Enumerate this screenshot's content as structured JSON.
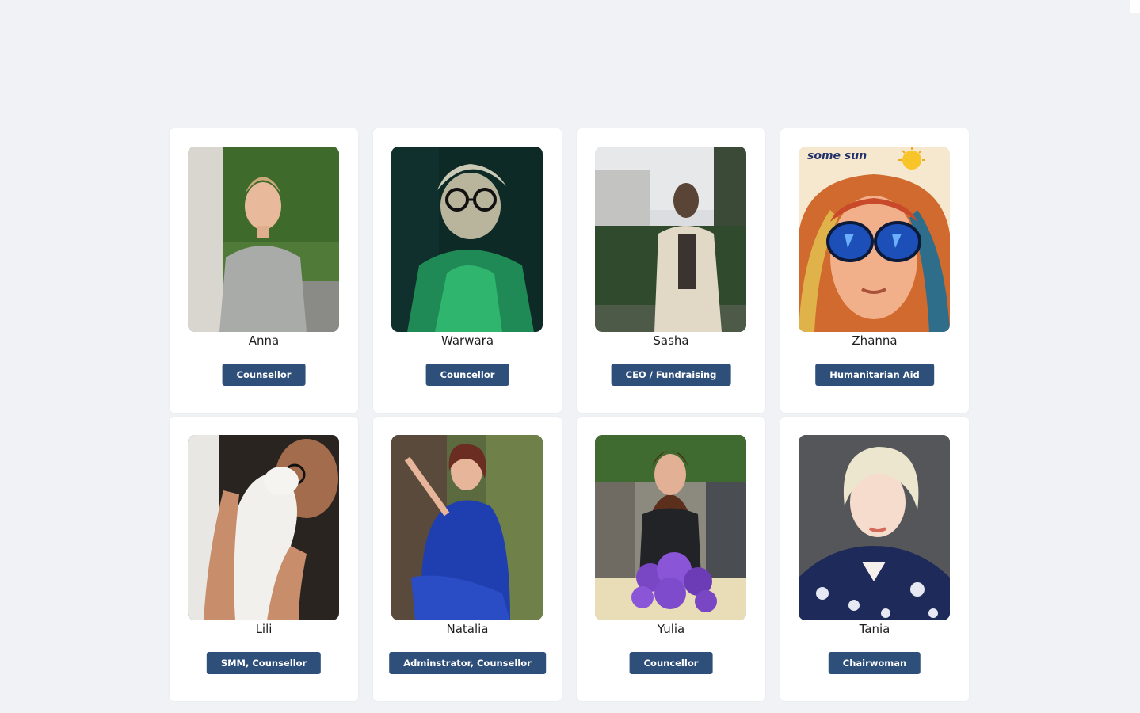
{
  "team": [
    {
      "name": "Anna",
      "role": "Counsellor",
      "photo_icon": "portrait-photo"
    },
    {
      "name": "Warwara",
      "role": "Councellor",
      "photo_icon": "portrait-photo"
    },
    {
      "name": "Sasha",
      "role": "CEO / Fundraising",
      "photo_icon": "portrait-photo"
    },
    {
      "name": "Zhanna",
      "role": "Humanitarian Aid",
      "photo_icon": "portrait-photo",
      "photo_caption": "some sun"
    },
    {
      "name": "Lili",
      "role": "SMM, Counsellor",
      "photo_icon": "portrait-photo"
    },
    {
      "name": "Natalia",
      "role": "Adminstrator, Counsellor",
      "photo_icon": "portrait-photo"
    },
    {
      "name": "Yulia",
      "role": "Councellor",
      "photo_icon": "portrait-photo"
    },
    {
      "name": "Tania",
      "role": "Chairwoman",
      "photo_icon": "portrait-photo"
    }
  ],
  "colors": {
    "background": "#f1f2f5",
    "card": "#ffffff",
    "button": "#2e4f7a"
  }
}
